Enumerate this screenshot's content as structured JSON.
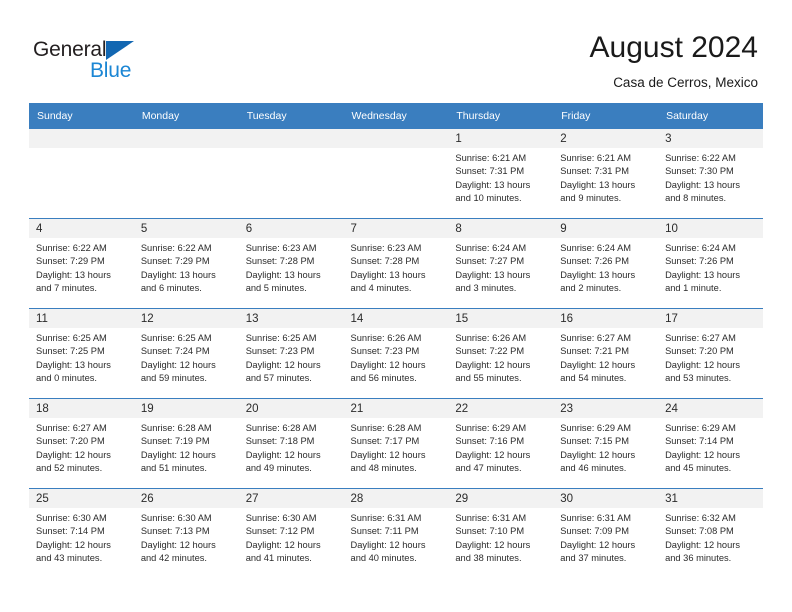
{
  "brand": {
    "name_part1": "General",
    "name_part2": "Blue",
    "color_dark": "#231f20",
    "color_blue": "#1b86d4",
    "triangle_color": "#1267b2"
  },
  "header": {
    "title": "August 2024",
    "subtitle": "Casa de Cerros, Mexico"
  },
  "theme": {
    "header_row_bg": "#3a7ebf",
    "daynum_band_bg": "#f2f2f2",
    "cell_bg": "#ffffff",
    "text_color": "#2b2b2b"
  },
  "weekday_headers": [
    "Sunday",
    "Monday",
    "Tuesday",
    "Wednesday",
    "Thursday",
    "Friday",
    "Saturday"
  ],
  "labels": {
    "sunrise_prefix": "Sunrise:",
    "sunset_prefix": "Sunset:",
    "daylight_prefix": "Daylight:"
  },
  "weeks": [
    [
      {
        "day": "",
        "line1": "",
        "line2": "",
        "line3": "",
        "line4": ""
      },
      {
        "day": "",
        "line1": "",
        "line2": "",
        "line3": "",
        "line4": ""
      },
      {
        "day": "",
        "line1": "",
        "line2": "",
        "line3": "",
        "line4": ""
      },
      {
        "day": "",
        "line1": "",
        "line2": "",
        "line3": "",
        "line4": ""
      },
      {
        "day": "1",
        "line1": "Sunrise: 6:21 AM",
        "line2": "Sunset: 7:31 PM",
        "line3": "Daylight: 13 hours",
        "line4": "and 10 minutes."
      },
      {
        "day": "2",
        "line1": "Sunrise: 6:21 AM",
        "line2": "Sunset: 7:31 PM",
        "line3": "Daylight: 13 hours",
        "line4": "and 9 minutes."
      },
      {
        "day": "3",
        "line1": "Sunrise: 6:22 AM",
        "line2": "Sunset: 7:30 PM",
        "line3": "Daylight: 13 hours",
        "line4": "and 8 minutes."
      }
    ],
    [
      {
        "day": "4",
        "line1": "Sunrise: 6:22 AM",
        "line2": "Sunset: 7:29 PM",
        "line3": "Daylight: 13 hours",
        "line4": "and 7 minutes."
      },
      {
        "day": "5",
        "line1": "Sunrise: 6:22 AM",
        "line2": "Sunset: 7:29 PM",
        "line3": "Daylight: 13 hours",
        "line4": "and 6 minutes."
      },
      {
        "day": "6",
        "line1": "Sunrise: 6:23 AM",
        "line2": "Sunset: 7:28 PM",
        "line3": "Daylight: 13 hours",
        "line4": "and 5 minutes."
      },
      {
        "day": "7",
        "line1": "Sunrise: 6:23 AM",
        "line2": "Sunset: 7:28 PM",
        "line3": "Daylight: 13 hours",
        "line4": "and 4 minutes."
      },
      {
        "day": "8",
        "line1": "Sunrise: 6:24 AM",
        "line2": "Sunset: 7:27 PM",
        "line3": "Daylight: 13 hours",
        "line4": "and 3 minutes."
      },
      {
        "day": "9",
        "line1": "Sunrise: 6:24 AM",
        "line2": "Sunset: 7:26 PM",
        "line3": "Daylight: 13 hours",
        "line4": "and 2 minutes."
      },
      {
        "day": "10",
        "line1": "Sunrise: 6:24 AM",
        "line2": "Sunset: 7:26 PM",
        "line3": "Daylight: 13 hours",
        "line4": "and 1 minute."
      }
    ],
    [
      {
        "day": "11",
        "line1": "Sunrise: 6:25 AM",
        "line2": "Sunset: 7:25 PM",
        "line3": "Daylight: 13 hours",
        "line4": "and 0 minutes."
      },
      {
        "day": "12",
        "line1": "Sunrise: 6:25 AM",
        "line2": "Sunset: 7:24 PM",
        "line3": "Daylight: 12 hours",
        "line4": "and 59 minutes."
      },
      {
        "day": "13",
        "line1": "Sunrise: 6:25 AM",
        "line2": "Sunset: 7:23 PM",
        "line3": "Daylight: 12 hours",
        "line4": "and 57 minutes."
      },
      {
        "day": "14",
        "line1": "Sunrise: 6:26 AM",
        "line2": "Sunset: 7:23 PM",
        "line3": "Daylight: 12 hours",
        "line4": "and 56 minutes."
      },
      {
        "day": "15",
        "line1": "Sunrise: 6:26 AM",
        "line2": "Sunset: 7:22 PM",
        "line3": "Daylight: 12 hours",
        "line4": "and 55 minutes."
      },
      {
        "day": "16",
        "line1": "Sunrise: 6:27 AM",
        "line2": "Sunset: 7:21 PM",
        "line3": "Daylight: 12 hours",
        "line4": "and 54 minutes."
      },
      {
        "day": "17",
        "line1": "Sunrise: 6:27 AM",
        "line2": "Sunset: 7:20 PM",
        "line3": "Daylight: 12 hours",
        "line4": "and 53 minutes."
      }
    ],
    [
      {
        "day": "18",
        "line1": "Sunrise: 6:27 AM",
        "line2": "Sunset: 7:20 PM",
        "line3": "Daylight: 12 hours",
        "line4": "and 52 minutes."
      },
      {
        "day": "19",
        "line1": "Sunrise: 6:28 AM",
        "line2": "Sunset: 7:19 PM",
        "line3": "Daylight: 12 hours",
        "line4": "and 51 minutes."
      },
      {
        "day": "20",
        "line1": "Sunrise: 6:28 AM",
        "line2": "Sunset: 7:18 PM",
        "line3": "Daylight: 12 hours",
        "line4": "and 49 minutes."
      },
      {
        "day": "21",
        "line1": "Sunrise: 6:28 AM",
        "line2": "Sunset: 7:17 PM",
        "line3": "Daylight: 12 hours",
        "line4": "and 48 minutes."
      },
      {
        "day": "22",
        "line1": "Sunrise: 6:29 AM",
        "line2": "Sunset: 7:16 PM",
        "line3": "Daylight: 12 hours",
        "line4": "and 47 minutes."
      },
      {
        "day": "23",
        "line1": "Sunrise: 6:29 AM",
        "line2": "Sunset: 7:15 PM",
        "line3": "Daylight: 12 hours",
        "line4": "and 46 minutes."
      },
      {
        "day": "24",
        "line1": "Sunrise: 6:29 AM",
        "line2": "Sunset: 7:14 PM",
        "line3": "Daylight: 12 hours",
        "line4": "and 45 minutes."
      }
    ],
    [
      {
        "day": "25",
        "line1": "Sunrise: 6:30 AM",
        "line2": "Sunset: 7:14 PM",
        "line3": "Daylight: 12 hours",
        "line4": "and 43 minutes."
      },
      {
        "day": "26",
        "line1": "Sunrise: 6:30 AM",
        "line2": "Sunset: 7:13 PM",
        "line3": "Daylight: 12 hours",
        "line4": "and 42 minutes."
      },
      {
        "day": "27",
        "line1": "Sunrise: 6:30 AM",
        "line2": "Sunset: 7:12 PM",
        "line3": "Daylight: 12 hours",
        "line4": "and 41 minutes."
      },
      {
        "day": "28",
        "line1": "Sunrise: 6:31 AM",
        "line2": "Sunset: 7:11 PM",
        "line3": "Daylight: 12 hours",
        "line4": "and 40 minutes."
      },
      {
        "day": "29",
        "line1": "Sunrise: 6:31 AM",
        "line2": "Sunset: 7:10 PM",
        "line3": "Daylight: 12 hours",
        "line4": "and 38 minutes."
      },
      {
        "day": "30",
        "line1": "Sunrise: 6:31 AM",
        "line2": "Sunset: 7:09 PM",
        "line3": "Daylight: 12 hours",
        "line4": "and 37 minutes."
      },
      {
        "day": "31",
        "line1": "Sunrise: 6:32 AM",
        "line2": "Sunset: 7:08 PM",
        "line3": "Daylight: 12 hours",
        "line4": "and 36 minutes."
      }
    ]
  ]
}
